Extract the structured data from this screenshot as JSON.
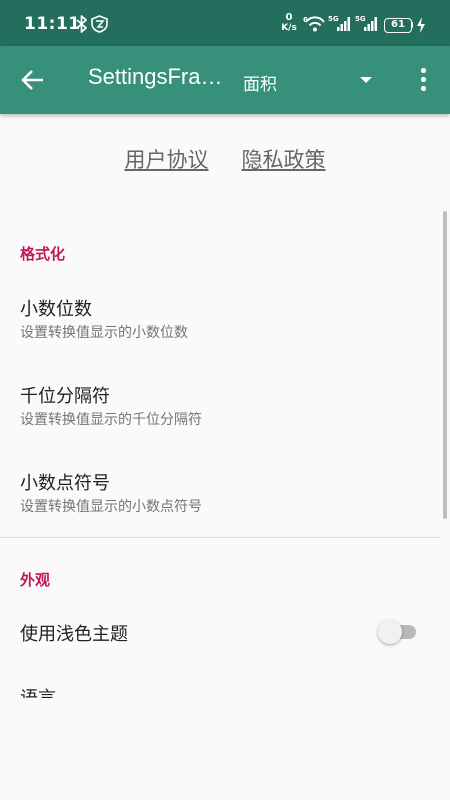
{
  "status_bar": {
    "time": "11:11",
    "net_speed_value": "0",
    "net_speed_unit": "K/s",
    "battery": "61",
    "icons": [
      "bluetooth-icon",
      "vpn-shield-icon",
      "wifi-icon",
      "signal-5g-icon",
      "signal-5g-icon",
      "battery-icon",
      "charging-icon"
    ]
  },
  "app_bar": {
    "title": "SettingsFragmentActivity",
    "spinner_value": "面积",
    "colors": {
      "status": "#236e5c",
      "toolbar": "#36907a",
      "accent": "#c2185b"
    }
  },
  "links": {
    "user_agreement": "用户协议",
    "privacy_policy": "隐私政策"
  },
  "sections": [
    {
      "title": "格式化",
      "items": [
        {
          "title": "小数位数",
          "summary": "设置转换值显示的小数位数"
        },
        {
          "title": "千位分隔符",
          "summary": "设置转换值显示的千位分隔符"
        },
        {
          "title": "小数点符号",
          "summary": "设置转换值显示的小数点符号"
        }
      ]
    },
    {
      "title": "外观",
      "items": [
        {
          "title": "使用浅色主题",
          "switch_on": false
        },
        {
          "title": "语言"
        }
      ]
    }
  ]
}
